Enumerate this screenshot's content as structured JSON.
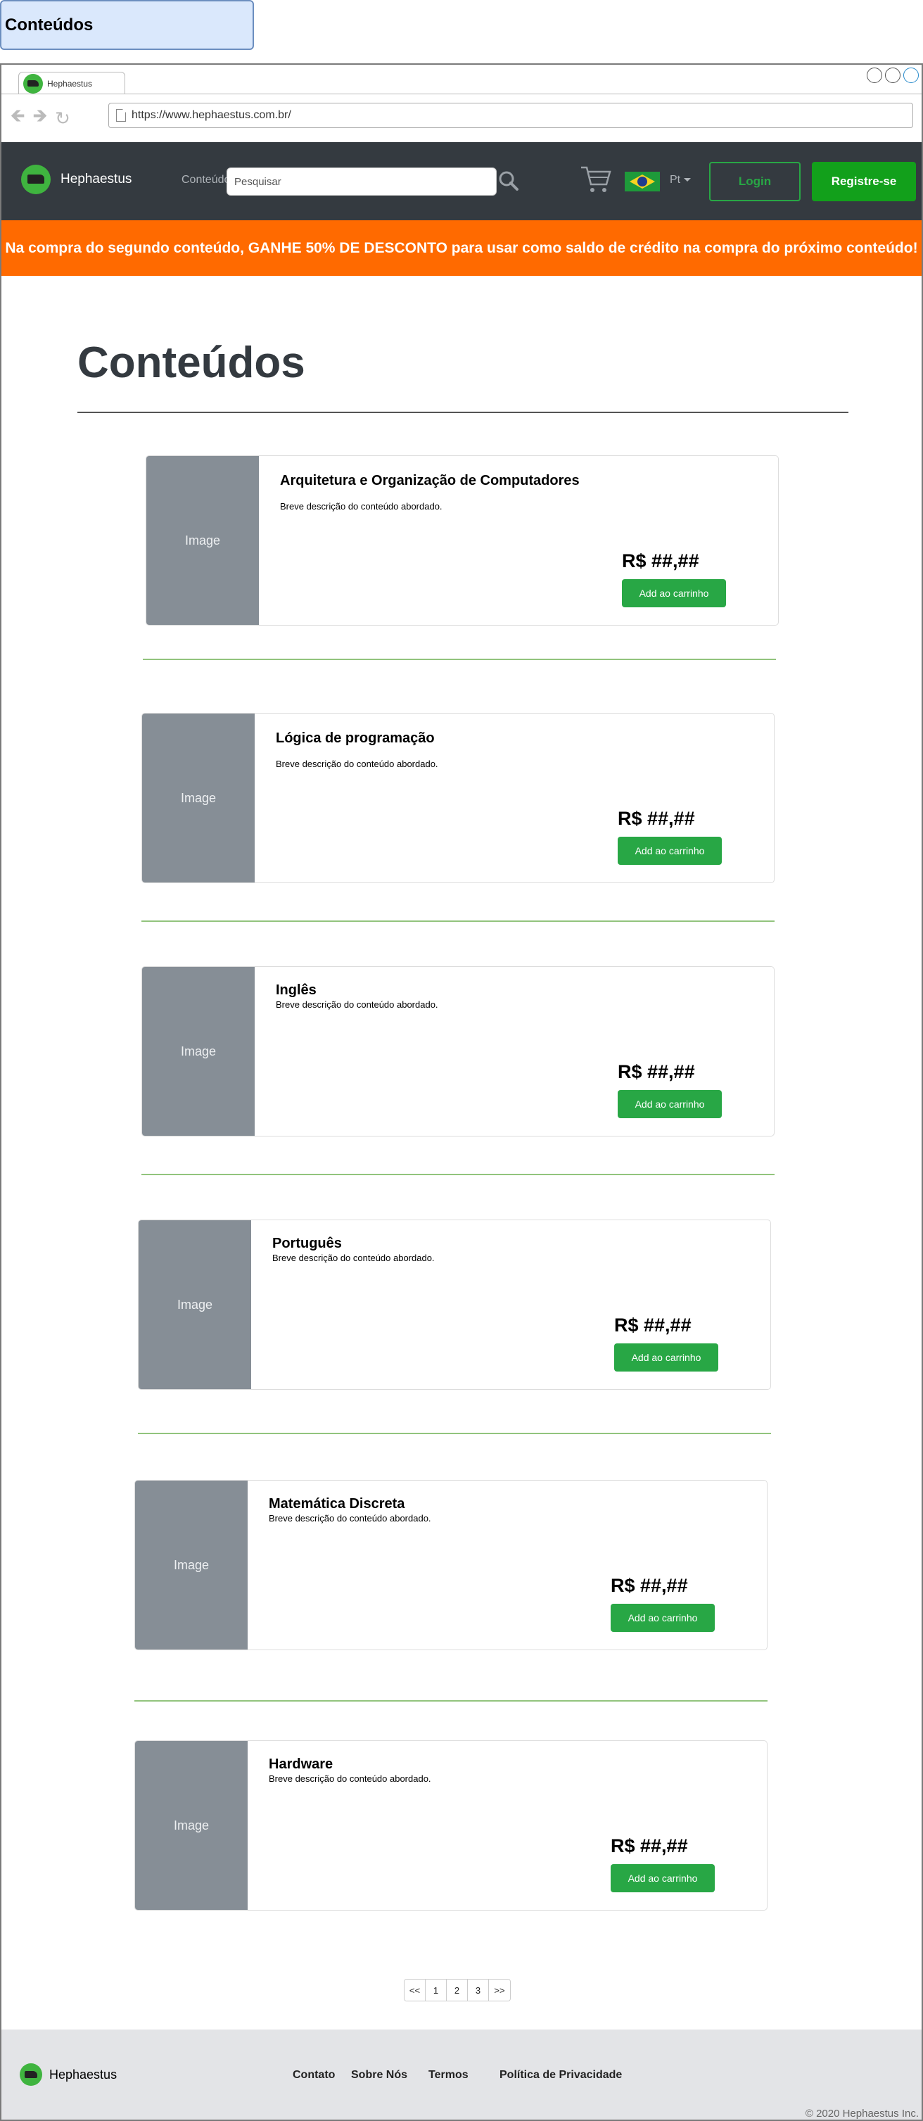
{
  "page_label": "Conteúdos",
  "browser": {
    "tab_title": "Hephaestus",
    "url": "https://www.hephaestus.com.br/"
  },
  "navbar": {
    "brand": "Hephaestus",
    "contents_menu": "Conteúdos",
    "search_placeholder": "Pesquisar",
    "language": "Pt",
    "login_label": "Login",
    "register_label": "Registre-se"
  },
  "promo": "Na compra do segundo conteúdo, GANHE 50% DE DESCONTO para usar como saldo de crédito na compra do próximo conteúdo!",
  "main": {
    "heading": "Conteúdos",
    "cards": [
      {
        "image_label": "Image",
        "title": "Arquitetura e Organização de Computadores",
        "description": "Breve descrição do conteúdo abordado.",
        "price": "R$ ##,##",
        "button": "Add ao carrinho"
      },
      {
        "image_label": "Image",
        "title": "Lógica de programação",
        "description": "Breve descrição do conteúdo abordado.",
        "price": "R$ ##,##",
        "button": "Add ao carrinho"
      },
      {
        "image_label": "Image",
        "title": "Inglês",
        "description": "Breve descrição do conteúdo abordado.",
        "price": "R$ ##,##",
        "button": "Add ao carrinho"
      },
      {
        "image_label": "Image",
        "title": "Português",
        "description": "Breve descrição do conteúdo abordado.",
        "price": "R$ ##,##",
        "button": "Add ao carrinho"
      },
      {
        "image_label": "Image",
        "title": "Matemática Discreta",
        "description": "Breve descrição do conteúdo abordado.",
        "price": "R$ ##,##",
        "button": "Add ao carrinho"
      },
      {
        "image_label": "Image",
        "title": "Hardware",
        "description": "Breve descrição do conteúdo abordado.",
        "price": "R$ ##,##",
        "button": "Add ao carrinho"
      }
    ]
  },
  "pagination": [
    "<<",
    "1",
    "2",
    "3",
    ">>"
  ],
  "footer": {
    "brand": "Hephaestus",
    "links": [
      "Contato",
      "Sobre Nós",
      "Termos",
      "Política de Privacidade"
    ],
    "copyright": "© 2020 Hephaestus Inc."
  },
  "colors": {
    "navbar": "#343a40",
    "promo": "#ff6a00",
    "accent_green": "#28a745",
    "register_green": "#12a01b",
    "image_placeholder": "#868e96",
    "footer": "#e3e4e7"
  }
}
